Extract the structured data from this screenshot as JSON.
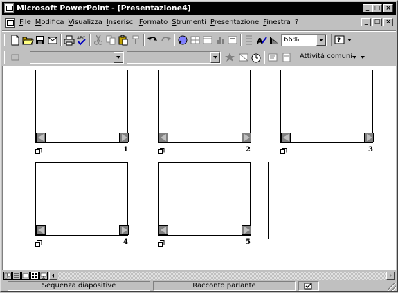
{
  "window": {
    "title": "Microsoft PowerPoint - [Presentazione4]",
    "controls": {
      "minimize": "_",
      "maximize": "□",
      "close": "×"
    }
  },
  "menubar": {
    "items": [
      "File",
      "Modifica",
      "Visualizza",
      "Inserisci",
      "Formato",
      "Strumenti",
      "Presentazione",
      "Finestra",
      "?"
    ]
  },
  "toolbar_standard": {
    "icons": [
      "new-icon",
      "open-icon",
      "save-icon",
      "email-icon",
      "print-icon",
      "spelling-icon",
      "cut-icon",
      "copy-icon",
      "paste-icon",
      "format-painter-icon",
      "undo-icon",
      "redo-icon",
      "hyperlink-icon",
      "tables-borders-icon",
      "insert-table-icon",
      "insert-chart-icon",
      "new-slide-icon",
      "expand-icon",
      "show-formatting-icon",
      "grayscale-icon",
      "help-icon"
    ],
    "zoom": "66%"
  },
  "toolbar_sorter": {
    "layout_combo_value": "",
    "transition_combo_value": "",
    "tasks_label": "Attività comuni"
  },
  "slides": [
    {
      "number": "1"
    },
    {
      "number": "2"
    },
    {
      "number": "3"
    },
    {
      "number": "4"
    },
    {
      "number": "5"
    }
  ],
  "statusbar": {
    "view": "Sequenza diapositive",
    "design": "Racconto parlante"
  }
}
